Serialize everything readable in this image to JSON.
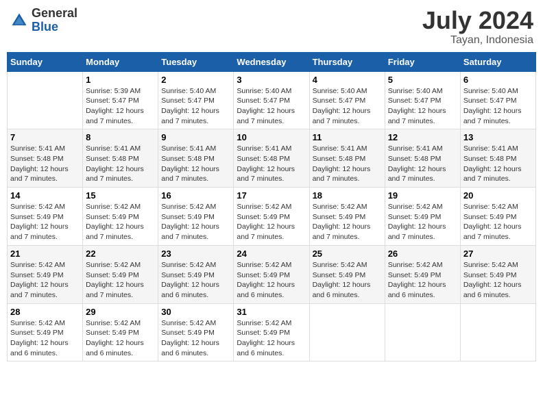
{
  "header": {
    "logo_line1": "General",
    "logo_line2": "Blue",
    "month": "July 2024",
    "location": "Tayan, Indonesia"
  },
  "weekdays": [
    "Sunday",
    "Monday",
    "Tuesday",
    "Wednesday",
    "Thursday",
    "Friday",
    "Saturday"
  ],
  "weeks": [
    [
      {
        "day": "",
        "info": ""
      },
      {
        "day": "1",
        "info": "Sunrise: 5:39 AM\nSunset: 5:47 PM\nDaylight: 12 hours\nand 7 minutes."
      },
      {
        "day": "2",
        "info": "Sunrise: 5:40 AM\nSunset: 5:47 PM\nDaylight: 12 hours\nand 7 minutes."
      },
      {
        "day": "3",
        "info": "Sunrise: 5:40 AM\nSunset: 5:47 PM\nDaylight: 12 hours\nand 7 minutes."
      },
      {
        "day": "4",
        "info": "Sunrise: 5:40 AM\nSunset: 5:47 PM\nDaylight: 12 hours\nand 7 minutes."
      },
      {
        "day": "5",
        "info": "Sunrise: 5:40 AM\nSunset: 5:47 PM\nDaylight: 12 hours\nand 7 minutes."
      },
      {
        "day": "6",
        "info": "Sunrise: 5:40 AM\nSunset: 5:47 PM\nDaylight: 12 hours\nand 7 minutes."
      }
    ],
    [
      {
        "day": "7",
        "info": ""
      },
      {
        "day": "8",
        "info": "Sunrise: 5:41 AM\nSunset: 5:48 PM\nDaylight: 12 hours\nand 7 minutes."
      },
      {
        "day": "9",
        "info": "Sunrise: 5:41 AM\nSunset: 5:48 PM\nDaylight: 12 hours\nand 7 minutes."
      },
      {
        "day": "10",
        "info": "Sunrise: 5:41 AM\nSunset: 5:48 PM\nDaylight: 12 hours\nand 7 minutes."
      },
      {
        "day": "11",
        "info": "Sunrise: 5:41 AM\nSunset: 5:48 PM\nDaylight: 12 hours\nand 7 minutes."
      },
      {
        "day": "12",
        "info": "Sunrise: 5:41 AM\nSunset: 5:48 PM\nDaylight: 12 hours\nand 7 minutes."
      },
      {
        "day": "13",
        "info": "Sunrise: 5:41 AM\nSunset: 5:48 PM\nDaylight: 12 hours\nand 7 minutes."
      }
    ],
    [
      {
        "day": "14",
        "info": ""
      },
      {
        "day": "15",
        "info": "Sunrise: 5:42 AM\nSunset: 5:49 PM\nDaylight: 12 hours\nand 7 minutes."
      },
      {
        "day": "16",
        "info": "Sunrise: 5:42 AM\nSunset: 5:49 PM\nDaylight: 12 hours\nand 7 minutes."
      },
      {
        "day": "17",
        "info": "Sunrise: 5:42 AM\nSunset: 5:49 PM\nDaylight: 12 hours\nand 7 minutes."
      },
      {
        "day": "18",
        "info": "Sunrise: 5:42 AM\nSunset: 5:49 PM\nDaylight: 12 hours\nand 7 minutes."
      },
      {
        "day": "19",
        "info": "Sunrise: 5:42 AM\nSunset: 5:49 PM\nDaylight: 12 hours\nand 7 minutes."
      },
      {
        "day": "20",
        "info": "Sunrise: 5:42 AM\nSunset: 5:49 PM\nDaylight: 12 hours\nand 7 minutes."
      }
    ],
    [
      {
        "day": "21",
        "info": ""
      },
      {
        "day": "22",
        "info": "Sunrise: 5:42 AM\nSunset: 5:49 PM\nDaylight: 12 hours\nand 7 minutes."
      },
      {
        "day": "23",
        "info": "Sunrise: 5:42 AM\nSunset: 5:49 PM\nDaylight: 12 hours\nand 6 minutes."
      },
      {
        "day": "24",
        "info": "Sunrise: 5:42 AM\nSunset: 5:49 PM\nDaylight: 12 hours\nand 6 minutes."
      },
      {
        "day": "25",
        "info": "Sunrise: 5:42 AM\nSunset: 5:49 PM\nDaylight: 12 hours\nand 6 minutes."
      },
      {
        "day": "26",
        "info": "Sunrise: 5:42 AM\nSunset: 5:49 PM\nDaylight: 12 hours\nand 6 minutes."
      },
      {
        "day": "27",
        "info": "Sunrise: 5:42 AM\nSunset: 5:49 PM\nDaylight: 12 hours\nand 6 minutes."
      }
    ],
    [
      {
        "day": "28",
        "info": "Sunrise: 5:42 AM\nSunset: 5:49 PM\nDaylight: 12 hours\nand 6 minutes."
      },
      {
        "day": "29",
        "info": "Sunrise: 5:42 AM\nSunset: 5:49 PM\nDaylight: 12 hours\nand 6 minutes."
      },
      {
        "day": "30",
        "info": "Sunrise: 5:42 AM\nSunset: 5:49 PM\nDaylight: 12 hours\nand 6 minutes."
      },
      {
        "day": "31",
        "info": "Sunrise: 5:42 AM\nSunset: 5:49 PM\nDaylight: 12 hours\nand 6 minutes."
      },
      {
        "day": "",
        "info": ""
      },
      {
        "day": "",
        "info": ""
      },
      {
        "day": "",
        "info": ""
      }
    ]
  ],
  "week1_sun_info": "Sunrise: 5:40 AM\nSunset: 5:47 PM\nDaylight: 12 hours\nand 7 minutes.",
  "week3_sun_info": "Sunrise: 5:41 AM\nSunset: 5:48 PM\nDaylight: 12 hours\nand 7 minutes.",
  "week5_sun_info": "Sunrise: 5:42 AM\nSunset: 5:49 PM\nDaylight: 12 hours\nand 7 minutes.",
  "week7_sun_info": "Sunrise: 5:42 AM\nSunset: 5:49 PM\nDaylight: 12 hours\nand 7 minutes."
}
